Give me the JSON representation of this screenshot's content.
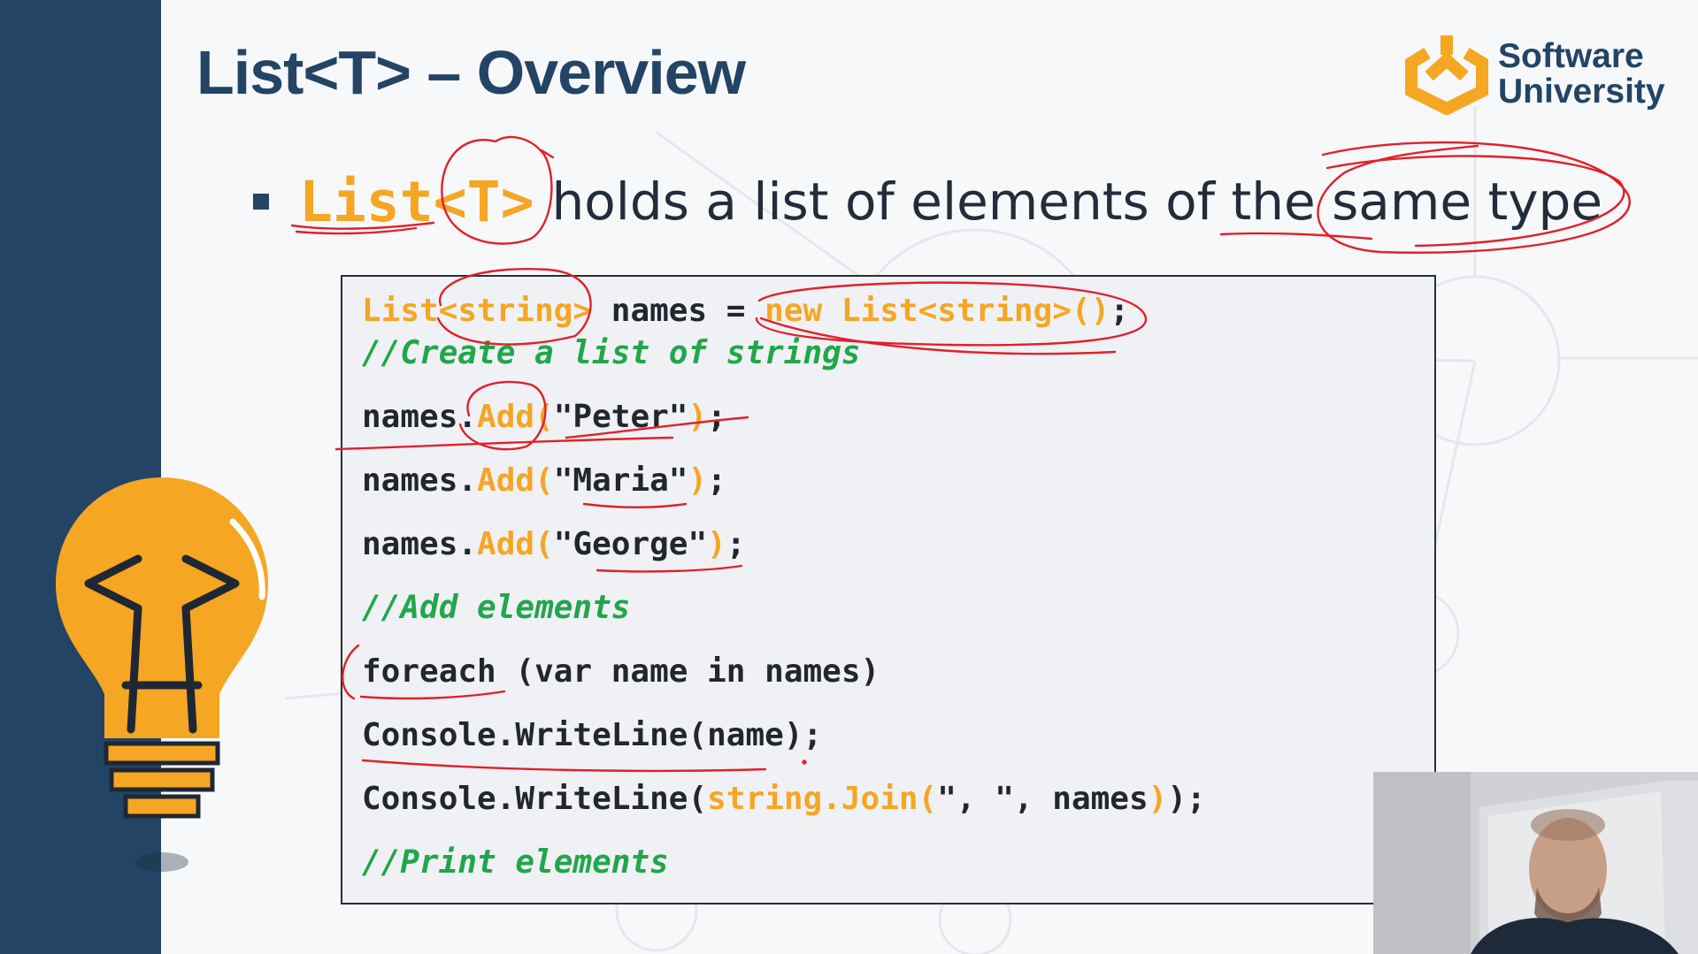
{
  "slide": {
    "title": "List<T> – Overview",
    "logo": {
      "line1": "Software",
      "line2": "University"
    },
    "bullet": {
      "code": "List<T>",
      "text": "holds a list of elements of the same type"
    },
    "code_lines": [
      [
        {
          "t": "List<string>",
          "c": "kw"
        },
        {
          "t": " names = ",
          "c": "plain"
        },
        {
          "t": "new List<string>()",
          "c": "kw"
        },
        {
          "t": ";",
          "c": "plain"
        }
      ],
      [
        {
          "t": "//Create a list of strings",
          "c": "comment"
        }
      ],
      [
        {
          "t": "names.",
          "c": "plain"
        },
        {
          "t": "Add(",
          "c": "kw"
        },
        {
          "t": "\"Peter\"",
          "c": "plain"
        },
        {
          "t": ")",
          "c": "kw"
        },
        {
          "t": ";",
          "c": "plain"
        }
      ],
      [
        {
          "t": "names.",
          "c": "plain"
        },
        {
          "t": "Add(",
          "c": "kw"
        },
        {
          "t": "\"Maria\"",
          "c": "plain"
        },
        {
          "t": ")",
          "c": "kw"
        },
        {
          "t": ";",
          "c": "plain"
        }
      ],
      [
        {
          "t": "names.",
          "c": "plain"
        },
        {
          "t": "Add(",
          "c": "kw"
        },
        {
          "t": "\"George\"",
          "c": "plain"
        },
        {
          "t": ")",
          "c": "kw"
        },
        {
          "t": ";",
          "c": "plain"
        }
      ],
      [
        {
          "t": "//Add elements",
          "c": "comment"
        }
      ],
      [
        {
          "t": "foreach (var name in names)",
          "c": "plain"
        }
      ],
      [
        {
          "t": "Console.WriteLine(name);",
          "c": "plain"
        }
      ],
      [
        {
          "t": "Console.WriteLine(",
          "c": "plain"
        },
        {
          "t": "string.Join(",
          "c": "kw"
        },
        {
          "t": "\", \", names",
          "c": "plain"
        },
        {
          "t": ")",
          "c": "kw"
        },
        {
          "t": ");",
          "c": "plain"
        }
      ],
      [
        {
          "t": "//Print elements",
          "c": "comment"
        }
      ]
    ]
  },
  "colors": {
    "sidebar": "#234465",
    "title": "#234465",
    "accent_orange": "#f5a623",
    "comment_green": "#21a64a",
    "annotation_red": "#e0212a",
    "code_background": "#eff1f5"
  },
  "icons": {
    "logo": "software-university-logo-icon",
    "bulb": "lightbulb-code-icon",
    "webcam": "presenter-webcam"
  }
}
